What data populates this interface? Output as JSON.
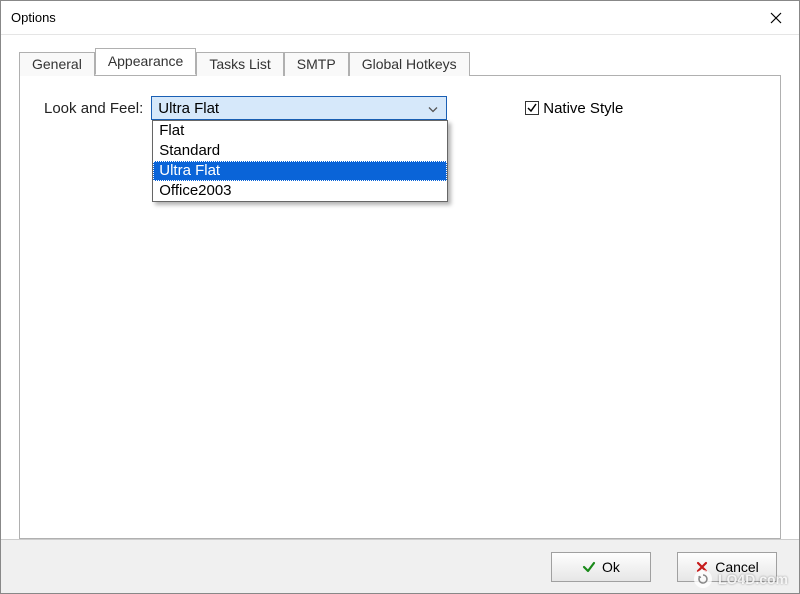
{
  "window": {
    "title": "Options"
  },
  "tabs": [
    {
      "label": "General",
      "active": false
    },
    {
      "label": "Appearance",
      "active": true
    },
    {
      "label": "Tasks List",
      "active": false
    },
    {
      "label": "SMTP",
      "active": false
    },
    {
      "label": "Global Hotkeys",
      "active": false
    }
  ],
  "appearance": {
    "look_and_feel_label": "Look and Feel:",
    "selected": "Ultra Flat",
    "options": [
      "Flat",
      "Standard",
      "Ultra Flat",
      "Office2003"
    ],
    "highlighted_index": 2,
    "native_style_label": "Native Style",
    "native_style_checked": true
  },
  "footer": {
    "ok_label": "Ok",
    "cancel_label": "Cancel"
  },
  "watermark": "LO4D.com"
}
